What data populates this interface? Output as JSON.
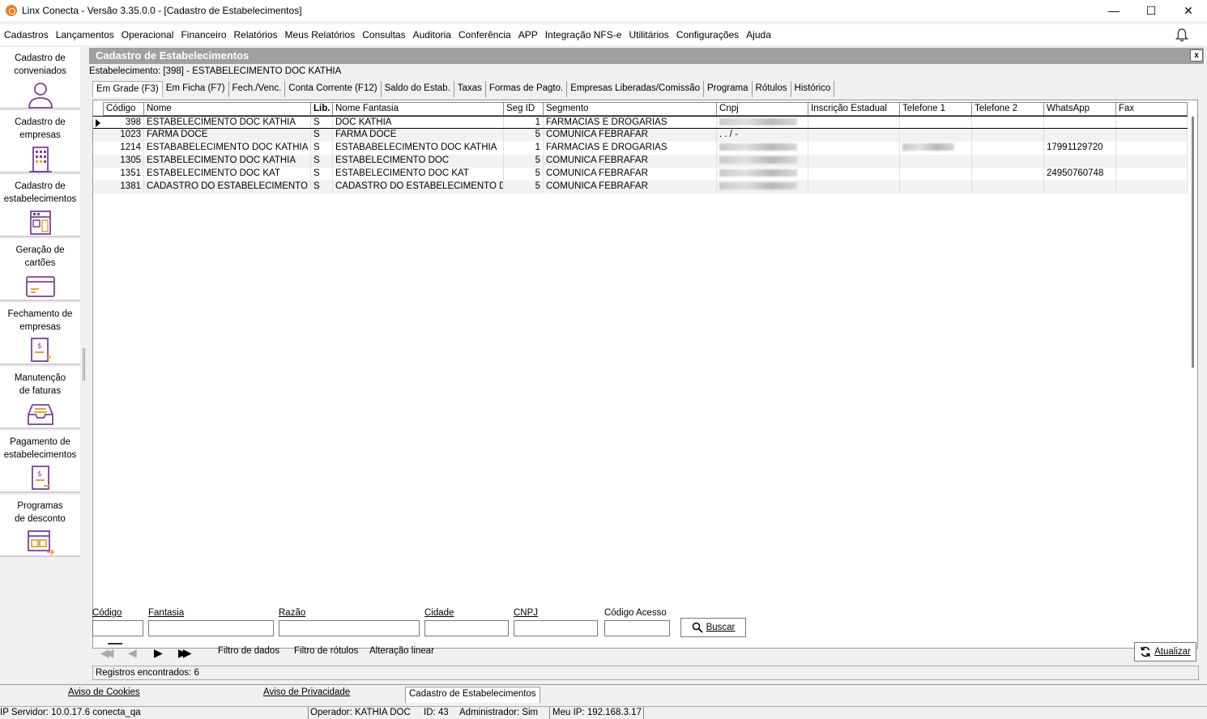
{
  "window": {
    "title": "Linx Conecta - Versão 3.35.0.0 - [Cadastro de Estabelecimentos]",
    "minimize": "—",
    "maximize": "☐",
    "close": "✕"
  },
  "menu": [
    "Cadastros",
    "Lançamentos",
    "Operacional",
    "Financeiro",
    "Relatórios",
    "Meus Relatórios",
    "Consultas",
    "Auditoria",
    "Conferência",
    "APP",
    "Integração NFS-e",
    "Utilitários",
    "Configurações",
    "Ajuda"
  ],
  "sidebar": [
    {
      "l1": "Cadastro de",
      "l2": "conveniados",
      "icon": "user-icon"
    },
    {
      "l1": "Cadastro de",
      "l2": "empresas",
      "icon": "building-icon"
    },
    {
      "l1": "Cadastro de",
      "l2": "estabelecimentos",
      "icon": "store-icon"
    },
    {
      "l1": "Geração de",
      "l2": "cartões",
      "icon": "card-icon"
    },
    {
      "l1": "Fechamento de",
      "l2": "empresas",
      "icon": "invoice-icon"
    },
    {
      "l1": "Manutenção",
      "l2": "de faturas",
      "icon": "inbox-icon"
    },
    {
      "l1": "Pagamento de",
      "l2": "estabelecimentos",
      "icon": "payment-icon"
    },
    {
      "l1": "Programas",
      "l2": "de desconto",
      "icon": "discount-icon"
    }
  ],
  "panel": {
    "title": "Cadastro de Estabelecimentos",
    "close": "x",
    "estabelecimento": "Estabelecimento: [398] - ESTABELECIMENTO DOC KATHIA"
  },
  "tabs": [
    "Em Grade (F3)",
    "Em Ficha (F7)",
    "Fech./Venc.",
    "Conta Corrente (F12)",
    "Saldo do Estab.",
    "Taxas",
    "Formas de Pagto.",
    "Empresas Liberadas/Comissão",
    "Programa",
    "Rótulos",
    "Histórico"
  ],
  "grid": {
    "columns": [
      "Código",
      "Nome",
      "Lib.",
      "Nome Fantasia",
      "Seg ID",
      "Segmento",
      "Cnpj",
      "Inscrição Estadual",
      "Telefone 1",
      "Telefone 2",
      "WhatsApp",
      "Fax"
    ],
    "rows": [
      {
        "codigo": "398",
        "nome": "ESTABELECIMENTO DOC KATHIA",
        "lib": "S",
        "fantasia": "DOC KATHIA",
        "seg": "1",
        "segmento": "FARMACIAS E DROGARIAS",
        "cnpj": "blur",
        "ie": "",
        "tel1": "",
        "tel2": "",
        "whatsapp": "",
        "fax": ""
      },
      {
        "codigo": "1023",
        "nome": "FARMA DOCE",
        "lib": "S",
        "fantasia": "FARMA DOCE",
        "seg": "5",
        "segmento": "COMUNICA FEBRAFAR",
        "cnpj": " .   .   /    -",
        "ie": "",
        "tel1": "",
        "tel2": "",
        "whatsapp": "",
        "fax": ""
      },
      {
        "codigo": "1214",
        "nome": "ESTABABELECIMENTO DOC KATHIA",
        "lib": "S",
        "fantasia": "ESTABABELECIMENTO DOC KATHIA",
        "seg": "1",
        "segmento": "FARMACIAS E DROGARIAS",
        "cnpj": "blur",
        "ie": "",
        "tel1": "blur",
        "tel2": "",
        "whatsapp": "17991129720",
        "fax": ""
      },
      {
        "codigo": "1305",
        "nome": "ESTABELECIMENTO DOC KATHIA",
        "lib": "S",
        "fantasia": "ESTABELECIMENTO DOC",
        "seg": "5",
        "segmento": "COMUNICA FEBRAFAR",
        "cnpj": "blur",
        "ie": "",
        "tel1": "",
        "tel2": "",
        "whatsapp": "",
        "fax": ""
      },
      {
        "codigo": "1351",
        "nome": "ESTABELECIMENTO DOC KAT",
        "lib": "S",
        "fantasia": "ESTABELECIMENTO DOC KAT",
        "seg": "5",
        "segmento": "COMUNICA FEBRAFAR",
        "cnpj": "blur",
        "ie": "",
        "tel1": "",
        "tel2": "",
        "whatsapp": "24950760748",
        "fax": ""
      },
      {
        "codigo": "1381",
        "nome": "CADASTRO DO ESTABELECIMENTO DO",
        "lib": "S",
        "fantasia": "CADASTRO DO ESTABELECIMENTO DOC",
        "seg": "5",
        "segmento": "COMUNICA FEBRAFAR",
        "cnpj": "blur",
        "ie": "",
        "tel1": "",
        "tel2": "",
        "whatsapp": "",
        "fax": ""
      }
    ]
  },
  "filters": {
    "codigo": "Código",
    "fantasia": "Fantasia",
    "razao": "Razão",
    "cidade": "Cidade",
    "cnpj": "CNPJ",
    "codigo_acesso": "Código Acesso",
    "buscar": "Buscar"
  },
  "nav": {
    "first": "◀◀",
    "prev": "◀",
    "next": "▶",
    "last": "▶▶",
    "filtro_dados": "Filtro de dados",
    "filtro_rotulos": "Filtro de rótulos",
    "alteracao_linear": "Alteração linear",
    "atualizar": "Atualizar"
  },
  "registros": "Registros encontrados: 6",
  "footer_tabs": [
    "Aviso de Cookies",
    "Aviso de Privacidade",
    "Cadastro de Estabelecimentos"
  ],
  "statusbar": {
    "servidor": "IP Servidor: 10.0.17.6 conecta_qa",
    "operador": "Operador: KATHIA DOC",
    "id": "ID: 43",
    "admin": "Administrador: Sim",
    "meu_ip": "Meu IP: 192.168.3.17"
  },
  "colors": {
    "accent": "#7b3fa0",
    "icon_orange": "#f0a030",
    "header_gray": "#a0a0a0"
  }
}
